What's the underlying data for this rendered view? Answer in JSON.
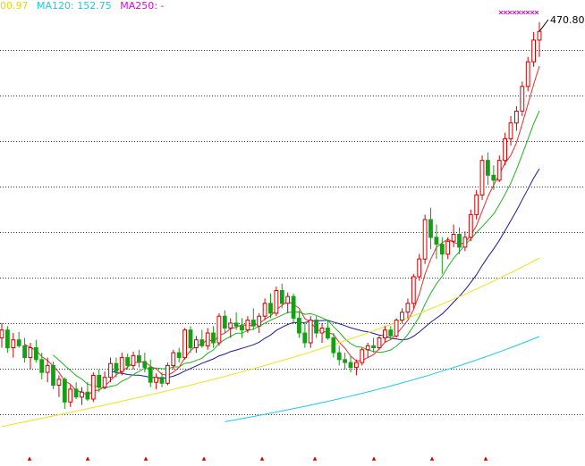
{
  "legend": {
    "ma_cut": "00.97",
    "ma120": "MA120: 152.75",
    "ma250": "MA250: -"
  },
  "price_tag": "470.80",
  "colors": {
    "up": "#d40000",
    "down": "#14a014",
    "ma5": "#e23030",
    "ma10": "#22b022",
    "ma20": "#1a1a99",
    "ma60": "#f0e020",
    "ma120": "#20c8e8",
    "ma250": "#d010d0",
    "grid": "#333333",
    "bottom_mark": "#d40000"
  },
  "chart_data": {
    "type": "candlestick",
    "title": "",
    "last_price": 470.8,
    "ylim": [
      50,
      490
    ],
    "y_gridlines": [
      452.1,
      406.0,
      359.8,
      313.6,
      267.4,
      221.3,
      175.1,
      128.9,
      82.7
    ],
    "candles": [
      [
        160,
        175,
        150,
        168
      ],
      [
        168,
        172,
        145,
        150
      ],
      [
        150,
        165,
        140,
        158
      ],
      [
        158,
        166,
        150,
        152
      ],
      [
        152,
        160,
        135,
        140
      ],
      [
        140,
        155,
        128,
        150
      ],
      [
        150,
        158,
        135,
        138
      ],
      [
        138,
        145,
        118,
        125
      ],
      [
        125,
        140,
        115,
        132
      ],
      [
        132,
        136,
        108,
        112
      ],
      [
        112,
        122,
        100,
        118
      ],
      [
        118,
        120,
        88,
        95
      ],
      [
        95,
        112,
        90,
        108
      ],
      [
        108,
        115,
        98,
        100
      ],
      [
        100,
        110,
        92,
        105
      ],
      [
        105,
        115,
        96,
        98
      ],
      [
        98,
        125,
        95,
        122
      ],
      [
        122,
        128,
        105,
        110
      ],
      [
        110,
        126,
        108,
        120
      ],
      [
        120,
        140,
        115,
        134
      ],
      [
        134,
        140,
        120,
        126
      ],
      [
        126,
        145,
        122,
        140
      ],
      [
        140,
        144,
        128,
        132
      ],
      [
        132,
        146,
        128,
        142
      ],
      [
        142,
        148,
        130,
        136
      ],
      [
        136,
        145,
        125,
        130
      ],
      [
        130,
        138,
        110,
        115
      ],
      [
        115,
        124,
        108,
        120
      ],
      [
        120,
        125,
        110,
        114
      ],
      [
        114,
        135,
        112,
        132
      ],
      [
        132,
        148,
        128,
        145
      ],
      [
        145,
        150,
        135,
        140
      ],
      [
        140,
        170,
        138,
        168
      ],
      [
        168,
        172,
        145,
        150
      ],
      [
        150,
        162,
        145,
        158
      ],
      [
        158,
        168,
        150,
        152
      ],
      [
        152,
        170,
        148,
        165
      ],
      [
        165,
        172,
        150,
        155
      ],
      [
        155,
        185,
        152,
        182
      ],
      [
        182,
        188,
        165,
        170
      ],
      [
        170,
        180,
        160,
        175
      ],
      [
        175,
        186,
        168,
        172
      ],
      [
        172,
        180,
        160,
        168
      ],
      [
        168,
        182,
        165,
        178
      ],
      [
        178,
        190,
        168,
        172
      ],
      [
        172,
        185,
        165,
        182
      ],
      [
        182,
        200,
        178,
        195
      ],
      [
        195,
        205,
        180,
        185
      ],
      [
        185,
        212,
        182,
        208
      ],
      [
        208,
        215,
        190,
        195
      ],
      [
        195,
        206,
        185,
        202
      ],
      [
        202,
        205,
        175,
        180
      ],
      [
        180,
        188,
        160,
        165
      ],
      [
        165,
        175,
        150,
        155
      ],
      [
        155,
        182,
        150,
        178
      ],
      [
        178,
        182,
        160,
        165
      ],
      [
        165,
        175,
        155,
        170
      ],
      [
        170,
        178,
        158,
        160
      ],
      [
        160,
        165,
        140,
        145
      ],
      [
        145,
        152,
        132,
        138
      ],
      [
        138,
        145,
        128,
        135
      ],
      [
        135,
        142,
        125,
        130
      ],
      [
        130,
        138,
        122,
        135
      ],
      [
        135,
        150,
        132,
        148
      ],
      [
        148,
        155,
        140,
        152
      ],
      [
        152,
        160,
        145,
        150
      ],
      [
        150,
        162,
        148,
        160
      ],
      [
        160,
        172,
        155,
        168
      ],
      [
        168,
        172,
        158,
        162
      ],
      [
        162,
        180,
        160,
        178
      ],
      [
        178,
        190,
        175,
        186
      ],
      [
        186,
        200,
        180,
        195
      ],
      [
        195,
        225,
        190,
        222
      ],
      [
        222,
        245,
        218,
        240
      ],
      [
        240,
        285,
        235,
        280
      ],
      [
        280,
        292,
        250,
        262
      ],
      [
        262,
        275,
        240,
        255
      ],
      [
        255,
        262,
        225,
        245
      ],
      [
        245,
        262,
        240,
        258
      ],
      [
        258,
        275,
        252,
        265
      ],
      [
        265,
        272,
        245,
        252
      ],
      [
        252,
        268,
        248,
        262
      ],
      [
        262,
        290,
        258,
        285
      ],
      [
        285,
        310,
        280,
        305
      ],
      [
        305,
        345,
        300,
        340
      ],
      [
        340,
        348,
        315,
        325
      ],
      [
        325,
        335,
        310,
        320
      ],
      [
        320,
        345,
        318,
        340
      ],
      [
        340,
        368,
        335,
        362
      ],
      [
        362,
        385,
        355,
        378
      ],
      [
        378,
        395,
        370,
        390
      ],
      [
        390,
        420,
        385,
        415
      ],
      [
        415,
        445,
        410,
        440
      ],
      [
        440,
        470,
        435,
        462
      ],
      [
        462,
        480,
        445,
        470.8
      ]
    ]
  }
}
